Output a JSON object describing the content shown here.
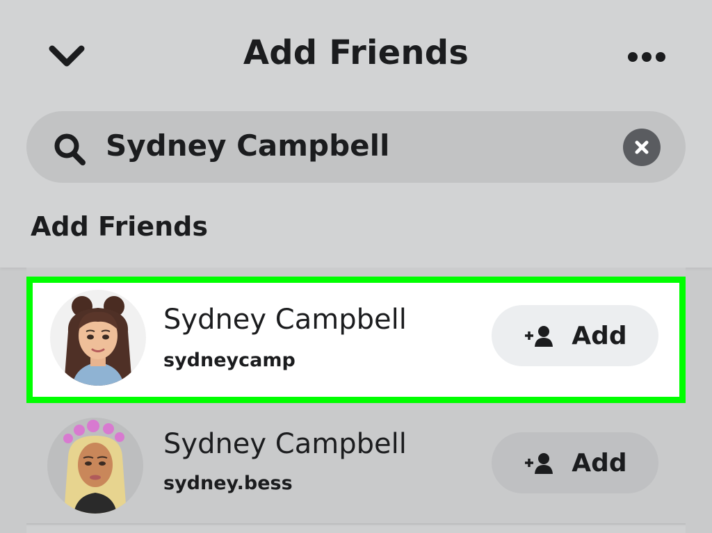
{
  "header": {
    "title": "Add Friends",
    "back_icon": "chevron-down-icon",
    "more_icon": "more-horizontal-icon"
  },
  "search": {
    "value": "Sydney Campbell",
    "search_icon": "search-icon",
    "clear_icon": "clear-icon"
  },
  "section": {
    "title": "Add Friends"
  },
  "results": [
    {
      "name": "Sydney Campbell",
      "username": "sydneycamp",
      "add_label": "Add",
      "highlighted": true
    },
    {
      "name": "Sydney Campbell",
      "username": "sydney.bess",
      "add_label": "Add",
      "highlighted": false
    }
  ],
  "colors": {
    "highlight_border": "#00ff00",
    "text": "#1b1c1e",
    "header_bg": "#d2d3d4"
  }
}
